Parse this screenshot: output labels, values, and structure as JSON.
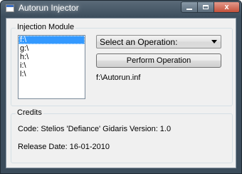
{
  "window": {
    "title": "Autorun Injector",
    "controls": {
      "minimize": "",
      "maximize": "",
      "close": "x"
    }
  },
  "icons": {
    "app": "app-window-icon",
    "minimize": "minimize-icon",
    "maximize": "maximize-icon",
    "close": "close-icon",
    "dropdown": "chevron-down-icon"
  },
  "injection_module": {
    "label": "Injection Module",
    "drives": [
      "f:\\",
      "g:\\",
      "h:\\",
      "i:\\",
      "l:\\"
    ],
    "selected_drive": "f:\\",
    "operation_select": {
      "value": "Select an Operation:"
    },
    "perform_button": "Perform Operation",
    "target_path": "f:\\Autorun.inf"
  },
  "credits": {
    "label": "Credits",
    "code": "Code: Stelios 'Defiance' Gidaris",
    "version": "Version:  1.0",
    "release_date": "Release Date: 16-01-2010"
  },
  "colors": {
    "titlebar": "#3e4f5e",
    "close_button": "#c3503a",
    "selection": "#3399ff",
    "client_bg": "#f0f0f0"
  }
}
